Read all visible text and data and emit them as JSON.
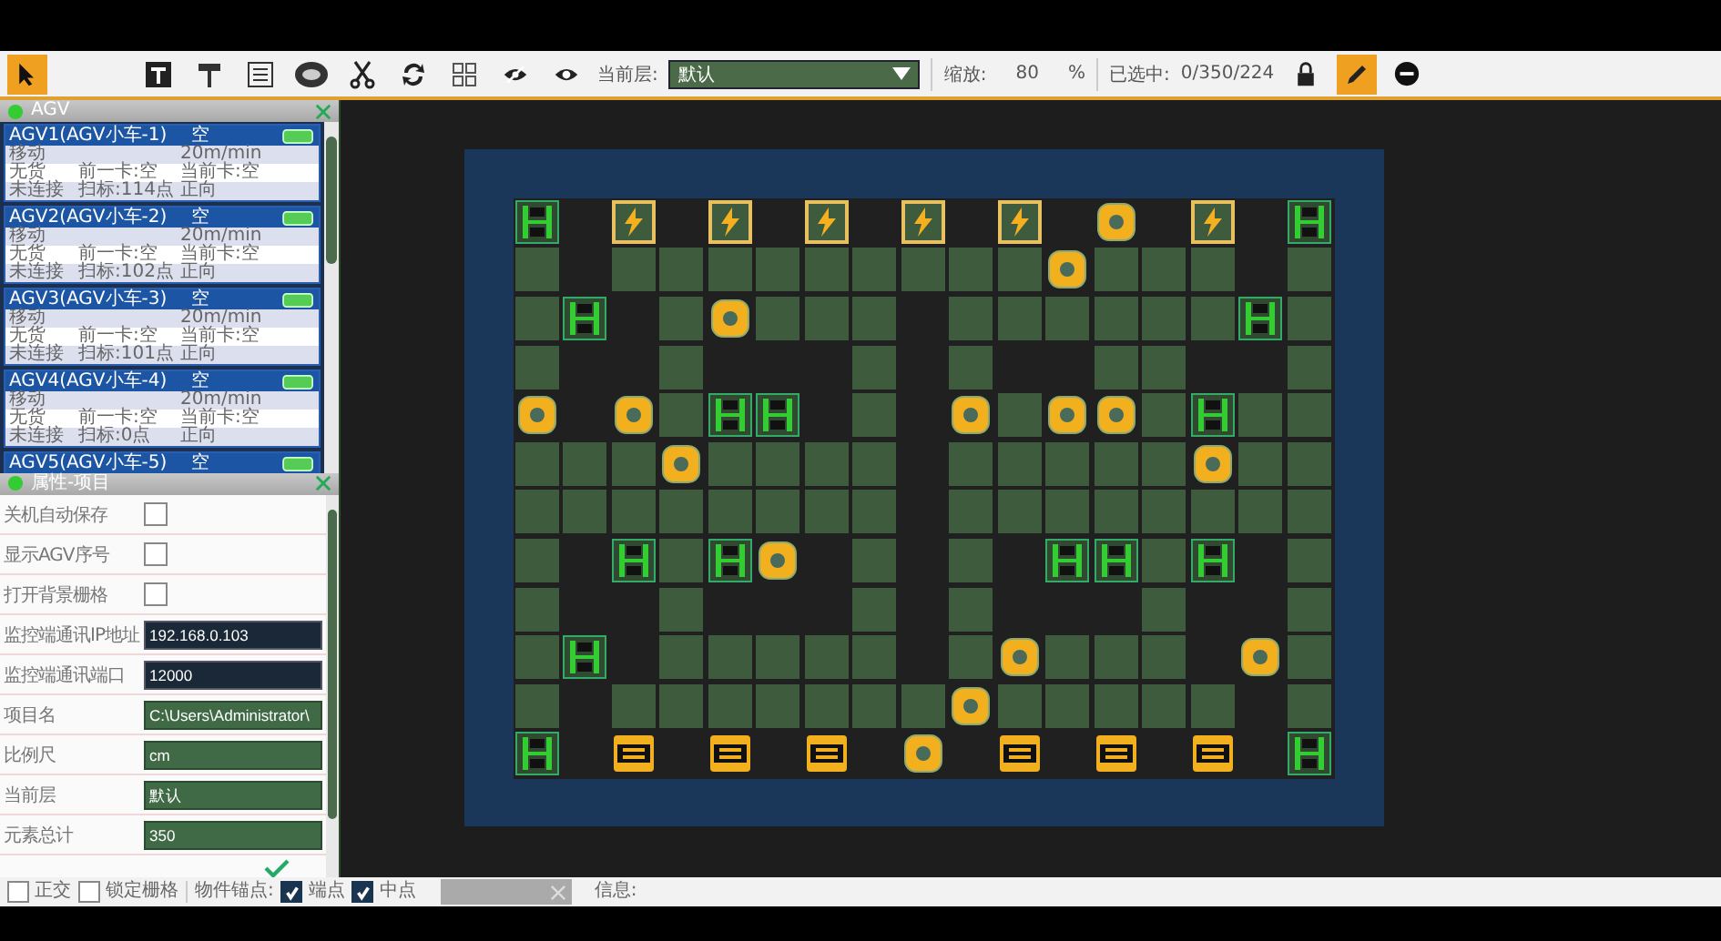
{
  "toolbar": {
    "left_tools": [
      {
        "kind": "pointer",
        "selected": true
      },
      {
        "kind": "text",
        "selected": false
      },
      {
        "kind": "roller",
        "selected": false
      },
      {
        "kind": "panel",
        "selected": false
      },
      {
        "kind": "badge",
        "selected": false
      },
      {
        "kind": "scissors",
        "selected": false
      },
      {
        "kind": "refresh",
        "selected": false
      },
      {
        "kind": "grid",
        "selected": false
      },
      {
        "kind": "eye_off",
        "selected": false
      },
      {
        "kind": "eye",
        "selected": false
      }
    ],
    "layer": {
      "label": "当前层:",
      "value": "默认"
    },
    "zoom": {
      "label": "缩放:",
      "value": "80",
      "unit": "%"
    },
    "selection": {
      "label": "已选中:",
      "value": "0/350/224"
    },
    "right_tools": [
      {
        "kind": "lock",
        "selected": false
      },
      {
        "kind": "pencil",
        "selected": true
      },
      {
        "kind": "minus",
        "selected": false
      }
    ]
  },
  "agv_panel": {
    "title": "AGV",
    "agvs": [
      {
        "name": "AGV1(AGV小车-1)",
        "status": "空",
        "rows": [
          [
            "移动",
            "",
            "20m/min"
          ],
          [
            "无货",
            "前一卡:空",
            "当前卡:空"
          ],
          [
            "未连接",
            "扫标:114点",
            "正向"
          ]
        ]
      },
      {
        "name": "AGV2(AGV小车-2)",
        "status": "空",
        "rows": [
          [
            "移动",
            "",
            "20m/min"
          ],
          [
            "无货",
            "前一卡:空",
            "当前卡:空"
          ],
          [
            "未连接",
            "扫标:102点",
            "正向"
          ]
        ]
      },
      {
        "name": "AGV3(AGV小车-3)",
        "status": "空",
        "rows": [
          [
            "移动",
            "",
            "20m/min"
          ],
          [
            "无货",
            "前一卡:空",
            "当前卡:空"
          ],
          [
            "未连接",
            "扫标:101点",
            "正向"
          ]
        ]
      },
      {
        "name": "AGV4(AGV小车-4)",
        "status": "空",
        "rows": [
          [
            "移动",
            "",
            "20m/min"
          ],
          [
            "无货",
            "前一卡:空",
            "当前卡:空"
          ],
          [
            "未连接",
            "扫标:0点",
            "正向"
          ]
        ]
      },
      {
        "name": "AGV5(AGV小车-5)",
        "status": "空"
      }
    ]
  },
  "properties_panel": {
    "title": "属性-项目",
    "rows": [
      {
        "kind": "checkbox",
        "label": "关机自动保存",
        "checked": false
      },
      {
        "kind": "checkbox",
        "label": "显示AGV序号",
        "checked": false
      },
      {
        "kind": "checkbox",
        "label": "打开背景栅格",
        "checked": false
      },
      {
        "kind": "input",
        "label": "监控端通讯IP地址",
        "value": "192.168.0.103"
      },
      {
        "kind": "input",
        "label": "监控端通讯端口",
        "value": "12000"
      },
      {
        "kind": "display",
        "label": "项目名",
        "value": "C:\\Users\\Administrator\\"
      },
      {
        "kind": "display",
        "label": "比例尺",
        "value": "cm"
      },
      {
        "kind": "display",
        "label": "当前层",
        "value": "默认"
      },
      {
        "kind": "display",
        "label": "元素总计",
        "value": "350"
      }
    ]
  },
  "map": {
    "rows": [
      [
        {
          "kind": "frame"
        },
        {
          "kind": "empty"
        },
        {
          "kind": "bolt"
        },
        {
          "kind": "empty"
        },
        {
          "kind": "bolt"
        },
        {
          "kind": "empty"
        },
        {
          "kind": "bolt"
        },
        {
          "kind": "empty"
        },
        {
          "kind": "bolt"
        },
        {
          "kind": "empty"
        },
        {
          "kind": "bolt"
        },
        {
          "kind": "empty"
        },
        {
          "kind": "round"
        },
        {
          "kind": "empty"
        },
        {
          "kind": "bolt"
        },
        {
          "kind": "empty"
        },
        {
          "kind": "frame"
        }
      ],
      [
        {
          "kind": "floor"
        },
        {
          "kind": "empty"
        },
        {
          "kind": "floor"
        },
        {
          "kind": "floor"
        },
        {
          "kind": "floor"
        },
        {
          "kind": "floor"
        },
        {
          "kind": "floor"
        },
        {
          "kind": "floor"
        },
        {
          "kind": "floor"
        },
        {
          "kind": "floor"
        },
        {
          "kind": "floor"
        },
        {
          "kind": "round"
        },
        {
          "kind": "floor"
        },
        {
          "kind": "floor"
        },
        {
          "kind": "floor"
        },
        {
          "kind": "empty"
        },
        {
          "kind": "floor"
        }
      ],
      [
        {
          "kind": "floor"
        },
        {
          "kind": "frame"
        },
        {
          "kind": "empty"
        },
        {
          "kind": "floor"
        },
        {
          "kind": "round"
        },
        {
          "kind": "floor"
        },
        {
          "kind": "floor"
        },
        {
          "kind": "floor"
        },
        {
          "kind": "empty"
        },
        {
          "kind": "floor"
        },
        {
          "kind": "floor"
        },
        {
          "kind": "floor"
        },
        {
          "kind": "floor"
        },
        {
          "kind": "floor"
        },
        {
          "kind": "floor"
        },
        {
          "kind": "frame"
        },
        {
          "kind": "floor"
        }
      ],
      [
        {
          "kind": "floor"
        },
        {
          "kind": "empty"
        },
        {
          "kind": "empty"
        },
        {
          "kind": "floor"
        },
        {
          "kind": "empty"
        },
        {
          "kind": "empty"
        },
        {
          "kind": "empty"
        },
        {
          "kind": "floor"
        },
        {
          "kind": "empty"
        },
        {
          "kind": "floor"
        },
        {
          "kind": "empty"
        },
        {
          "kind": "empty"
        },
        {
          "kind": "floor"
        },
        {
          "kind": "floor"
        },
        {
          "kind": "empty"
        },
        {
          "kind": "empty"
        },
        {
          "kind": "floor"
        }
      ],
      [
        {
          "kind": "round"
        },
        {
          "kind": "empty"
        },
        {
          "kind": "round"
        },
        {
          "kind": "floor"
        },
        {
          "kind": "frame"
        },
        {
          "kind": "frame"
        },
        {
          "kind": "empty"
        },
        {
          "kind": "floor"
        },
        {
          "kind": "empty"
        },
        {
          "kind": "round"
        },
        {
          "kind": "floor"
        },
        {
          "kind": "round"
        },
        {
          "kind": "round"
        },
        {
          "kind": "floor"
        },
        {
          "kind": "frame"
        },
        {
          "kind": "floor"
        },
        {
          "kind": "floor"
        }
      ],
      [
        {
          "kind": "floor"
        },
        {
          "kind": "floor"
        },
        {
          "kind": "floor"
        },
        {
          "kind": "round"
        },
        {
          "kind": "floor"
        },
        {
          "kind": "floor"
        },
        {
          "kind": "floor"
        },
        {
          "kind": "floor"
        },
        {
          "kind": "empty"
        },
        {
          "kind": "floor"
        },
        {
          "kind": "floor"
        },
        {
          "kind": "floor"
        },
        {
          "kind": "floor"
        },
        {
          "kind": "floor"
        },
        {
          "kind": "round"
        },
        {
          "kind": "floor"
        },
        {
          "kind": "floor"
        }
      ],
      [
        {
          "kind": "floor"
        },
        {
          "kind": "floor"
        },
        {
          "kind": "floor"
        },
        {
          "kind": "floor"
        },
        {
          "kind": "floor"
        },
        {
          "kind": "floor"
        },
        {
          "kind": "floor"
        },
        {
          "kind": "floor"
        },
        {
          "kind": "empty"
        },
        {
          "kind": "floor"
        },
        {
          "kind": "floor"
        },
        {
          "kind": "floor"
        },
        {
          "kind": "floor"
        },
        {
          "kind": "floor"
        },
        {
          "kind": "floor"
        },
        {
          "kind": "floor"
        },
        {
          "kind": "floor"
        }
      ],
      [
        {
          "kind": "floor"
        },
        {
          "kind": "empty"
        },
        {
          "kind": "frame"
        },
        {
          "kind": "floor"
        },
        {
          "kind": "frame"
        },
        {
          "kind": "round"
        },
        {
          "kind": "empty"
        },
        {
          "kind": "floor"
        },
        {
          "kind": "empty"
        },
        {
          "kind": "floor"
        },
        {
          "kind": "empty"
        },
        {
          "kind": "frame"
        },
        {
          "kind": "frame"
        },
        {
          "kind": "floor"
        },
        {
          "kind": "frame"
        },
        {
          "kind": "empty"
        },
        {
          "kind": "floor"
        }
      ],
      [
        {
          "kind": "floor"
        },
        {
          "kind": "empty"
        },
        {
          "kind": "empty"
        },
        {
          "kind": "floor"
        },
        {
          "kind": "empty"
        },
        {
          "kind": "empty"
        },
        {
          "kind": "empty"
        },
        {
          "kind": "floor"
        },
        {
          "kind": "empty"
        },
        {
          "kind": "floor"
        },
        {
          "kind": "empty"
        },
        {
          "kind": "empty"
        },
        {
          "kind": "empty"
        },
        {
          "kind": "floor"
        },
        {
          "kind": "empty"
        },
        {
          "kind": "empty"
        },
        {
          "kind": "floor"
        }
      ],
      [
        {
          "kind": "floor"
        },
        {
          "kind": "frame"
        },
        {
          "kind": "empty"
        },
        {
          "kind": "floor"
        },
        {
          "kind": "floor"
        },
        {
          "kind": "floor"
        },
        {
          "kind": "floor"
        },
        {
          "kind": "floor"
        },
        {
          "kind": "empty"
        },
        {
          "kind": "floor"
        },
        {
          "kind": "round"
        },
        {
          "kind": "floor"
        },
        {
          "kind": "floor"
        },
        {
          "kind": "floor"
        },
        {
          "kind": "empty"
        },
        {
          "kind": "round"
        },
        {
          "kind": "floor"
        }
      ],
      [
        {
          "kind": "floor"
        },
        {
          "kind": "empty"
        },
        {
          "kind": "floor"
        },
        {
          "kind": "floor"
        },
        {
          "kind": "floor"
        },
        {
          "kind": "floor"
        },
        {
          "kind": "floor"
        },
        {
          "kind": "floor"
        },
        {
          "kind": "floor"
        },
        {
          "kind": "round"
        },
        {
          "kind": "floor"
        },
        {
          "kind": "floor"
        },
        {
          "kind": "floor"
        },
        {
          "kind": "floor"
        },
        {
          "kind": "floor"
        },
        {
          "kind": "empty"
        },
        {
          "kind": "floor"
        }
      ],
      [
        {
          "kind": "frame"
        },
        {
          "kind": "empty"
        },
        {
          "kind": "bone"
        },
        {
          "kind": "empty"
        },
        {
          "kind": "bone"
        },
        {
          "kind": "empty"
        },
        {
          "kind": "bone"
        },
        {
          "kind": "empty"
        },
        {
          "kind": "round"
        },
        {
          "kind": "empty"
        },
        {
          "kind": "bone"
        },
        {
          "kind": "empty"
        },
        {
          "kind": "bone"
        },
        {
          "kind": "empty"
        },
        {
          "kind": "bone"
        },
        {
          "kind": "empty"
        },
        {
          "kind": "frame"
        }
      ]
    ]
  },
  "status_bar": {
    "options": [
      {
        "label": "正交",
        "checked": false
      },
      {
        "label": "锁定栅格",
        "checked": false
      }
    ],
    "anchor_label": "物件锚点:",
    "anchors": [
      {
        "label": "端点",
        "checked": true
      },
      {
        "label": "中点",
        "checked": true
      }
    ],
    "info_label": "信息:"
  }
}
